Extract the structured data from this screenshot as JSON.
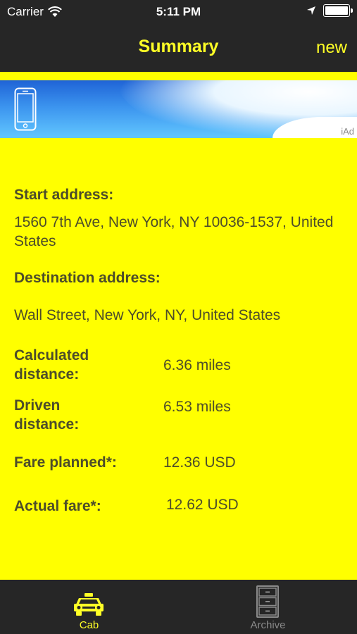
{
  "status_bar": {
    "carrier": "Carrier",
    "time": "5:11 PM"
  },
  "nav": {
    "title": "Summary",
    "new_label": "new"
  },
  "ad": {
    "label": "iAd"
  },
  "summary": {
    "start_label": "Start address:",
    "start_value": "1560 7th Ave, New York, NY  10036-1537, United States",
    "destination_label": "Destination address:",
    "destination_value": "Wall Street, New York, NY, United States",
    "calc_distance_label": "Calculated distance:",
    "calc_distance_value": "6.36 miles",
    "driven_distance_label": "Driven distance:",
    "driven_distance_value": "6.53 miles",
    "fare_planned_label": "Fare planned*:",
    "fare_planned_value": "12.36 USD",
    "actual_fare_label": "Actual fare*:",
    "actual_fare_value": "12.62 USD"
  },
  "tabs": [
    {
      "label": "Cab",
      "icon": "taxi-icon",
      "active": true
    },
    {
      "label": "Archive",
      "icon": "cabinet-icon",
      "active": false
    }
  ],
  "colors": {
    "accent": "#ffff26",
    "background": "#ffff00",
    "bar": "#262626",
    "text": "#4d4d2a"
  }
}
